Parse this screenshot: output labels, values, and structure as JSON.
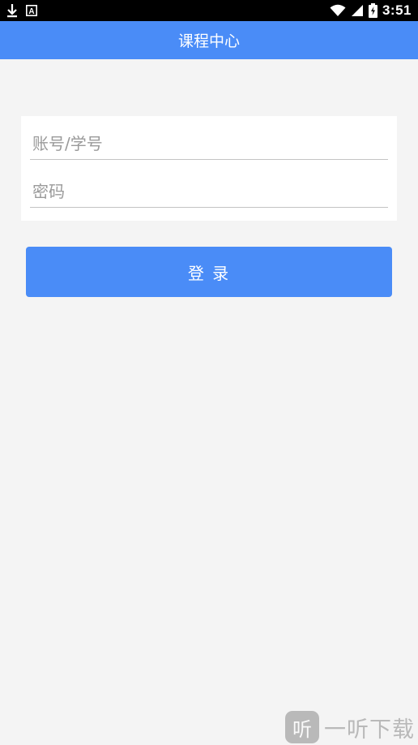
{
  "status_bar": {
    "time": "3:51",
    "left_icons": [
      "download-icon",
      "a-notification-icon"
    ],
    "right_icons": [
      "wifi-icon",
      "signal-icon",
      "battery-charging-icon"
    ],
    "notification_letter": "A"
  },
  "header": {
    "title": "课程中心"
  },
  "form": {
    "account_placeholder": "账号/学号",
    "account_value": "",
    "password_placeholder": "密码",
    "password_value": ""
  },
  "login_button": {
    "label": "登 录"
  },
  "watermark": {
    "logo_char": "听",
    "text": "一听下载"
  },
  "colors": {
    "accent": "#4a8cf7",
    "background": "#f4f4f4",
    "card": "#ffffff",
    "placeholder": "#9a9a9a"
  }
}
